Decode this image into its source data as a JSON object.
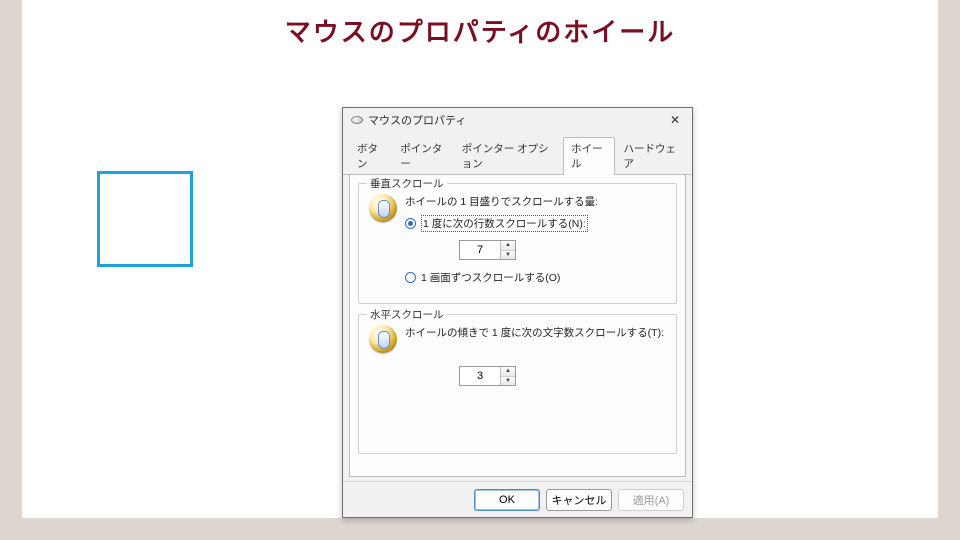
{
  "page": {
    "title": "マウスのプロパティのホイール"
  },
  "dialog": {
    "title": "マウスのプロパティ",
    "tabs": [
      {
        "label": "ボタン"
      },
      {
        "label": "ポインター"
      },
      {
        "label": "ポインター オプション"
      },
      {
        "label": "ホイール"
      },
      {
        "label": "ハードウェア"
      }
    ],
    "active_tab_index": 3,
    "vertical": {
      "legend": "垂直スクロール",
      "desc": "ホイールの 1 目盛りでスクロールする量:",
      "radio_lines": "1 度に次の行数スクロールする(N):",
      "lines_value": "7",
      "radio_screen": "1 画面ずつスクロールする(O)",
      "selected": "lines"
    },
    "horizontal": {
      "legend": "水平スクロール",
      "desc": "ホイールの傾きで 1 度に次の文字数スクロールする(T):",
      "chars_value": "3"
    },
    "buttons": {
      "ok": "OK",
      "cancel": "キャンセル",
      "apply": "適用(A)"
    }
  }
}
